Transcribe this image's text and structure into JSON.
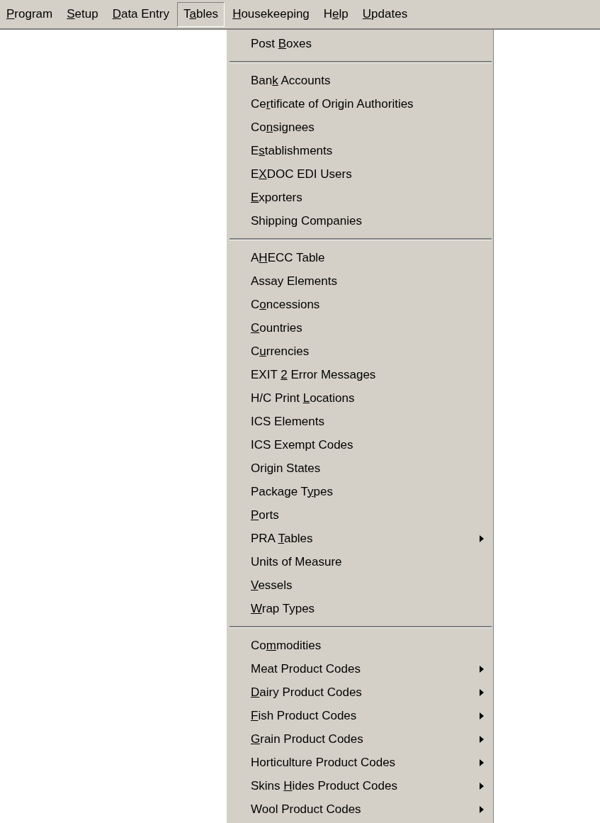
{
  "menu_bar": [
    {
      "key": "P",
      "post": "rogram",
      "selected": false
    },
    {
      "key": "S",
      "post": "etup",
      "selected": false
    },
    {
      "key": "D",
      "post": "ata Entry",
      "selected": false
    },
    {
      "pre": "T",
      "key": "a",
      "post": "bles",
      "selected": true
    },
    {
      "key": "H",
      "post": "ousekeeping",
      "selected": false
    },
    {
      "pre": "H",
      "key": "e",
      "post": "lp",
      "selected": false
    },
    {
      "key": "U",
      "post": "pdates",
      "selected": false
    }
  ],
  "tables_menu": [
    {
      "kind": "item",
      "pre": "Post ",
      "key": "B",
      "post": "oxes",
      "submenu": false
    },
    {
      "kind": "separator"
    },
    {
      "kind": "item",
      "pre": "Ban",
      "key": "k",
      "post": " Accounts",
      "submenu": false
    },
    {
      "kind": "item",
      "pre": "Ce",
      "key": "r",
      "post": "tificate of Origin Authorities",
      "submenu": false
    },
    {
      "kind": "item",
      "pre": "Co",
      "key": "n",
      "post": "signees",
      "submenu": false
    },
    {
      "kind": "item",
      "pre": "E",
      "key": "s",
      "post": "tablishments",
      "submenu": false
    },
    {
      "kind": "item",
      "pre": "E",
      "key": "X",
      "post": "DOC EDI Users",
      "submenu": false
    },
    {
      "kind": "item",
      "key": "E",
      "post": "xporters",
      "submenu": false
    },
    {
      "kind": "item",
      "pre": "Shipping Companies",
      "submenu": false
    },
    {
      "kind": "separator"
    },
    {
      "kind": "item",
      "pre": "A",
      "key": "H",
      "post": "ECC Table",
      "submenu": false
    },
    {
      "kind": "item",
      "pre": "Assay Elements",
      "submenu": false
    },
    {
      "kind": "item",
      "pre": "C",
      "key": "o",
      "post": "ncessions",
      "submenu": false
    },
    {
      "kind": "item",
      "key": "C",
      "post": "ountries",
      "submenu": false
    },
    {
      "kind": "item",
      "pre": "C",
      "key": "u",
      "post": "rrencies",
      "submenu": false
    },
    {
      "kind": "item",
      "pre": "EXIT ",
      "key": "2",
      "post": " Error Messages",
      "submenu": false
    },
    {
      "kind": "item",
      "pre": "H/C Print ",
      "key": "L",
      "post": "ocations",
      "submenu": false
    },
    {
      "kind": "item",
      "pre": "ICS Elements",
      "submenu": false
    },
    {
      "kind": "item",
      "pre": "ICS Exempt Codes",
      "submenu": false
    },
    {
      "kind": "item",
      "pre": "Origin States",
      "submenu": false
    },
    {
      "kind": "item",
      "pre": "Package T",
      "key": "y",
      "post": "pes",
      "submenu": false
    },
    {
      "kind": "item",
      "key": "P",
      "post": "orts",
      "submenu": false
    },
    {
      "kind": "item",
      "pre": "PRA ",
      "key": "T",
      "post": "ables",
      "submenu": true
    },
    {
      "kind": "item",
      "pre": "Units of Measure",
      "submenu": false
    },
    {
      "kind": "item",
      "key": "V",
      "post": "essels",
      "submenu": false
    },
    {
      "kind": "item",
      "key": "W",
      "post": "rap Types",
      "submenu": false
    },
    {
      "kind": "separator"
    },
    {
      "kind": "item",
      "pre": "Co",
      "key": "m",
      "post": "modities",
      "submenu": false
    },
    {
      "kind": "item",
      "pre": "Meat Product Codes",
      "submenu": true
    },
    {
      "kind": "item",
      "key": "D",
      "post": "airy Product Codes",
      "submenu": true
    },
    {
      "kind": "item",
      "key": "F",
      "post": "ish Product Codes",
      "submenu": true
    },
    {
      "kind": "item",
      "key": "G",
      "post": "rain Product Codes",
      "submenu": true
    },
    {
      "kind": "item",
      "pre": "Horticulture Product Codes",
      "submenu": true
    },
    {
      "kind": "item",
      "pre": "Skins ",
      "key": "H",
      "post": "ides Product Codes",
      "submenu": true
    },
    {
      "kind": "item",
      "pre": "Wool Product Codes",
      "submenu": true
    }
  ]
}
